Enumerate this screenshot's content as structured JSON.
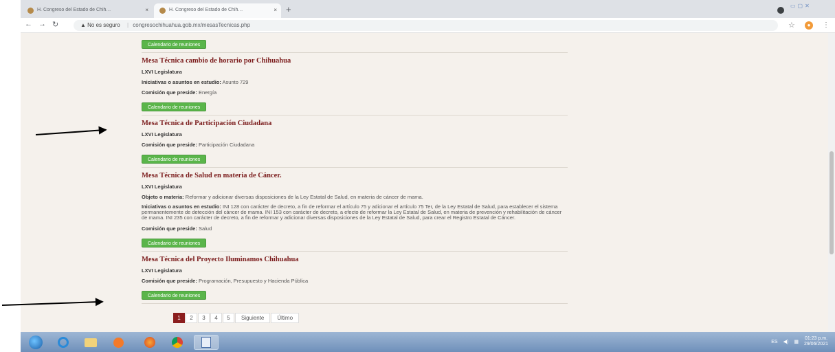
{
  "browser": {
    "tabs": [
      {
        "label": "H. Congreso del Estado de Chih…",
        "close": "×"
      },
      {
        "label": "H. Congreso del Estado de Chih…",
        "close": "×"
      }
    ],
    "new_tab": "+",
    "url_warning": "▲ No es seguro",
    "url": "congresochihuahua.gob.mx/mesasTecnicas.php"
  },
  "content": {
    "top_button": "Calendario de reuniones",
    "items": [
      {
        "title": "Mesa Técnica cambio de horario por Chihuahua",
        "legislatura": "LXVI Legislatura",
        "iniciativas_label": "Iniciativas o asuntos en estudio:",
        "iniciativas_value": " Asunto 729",
        "comision_label": "Comisión que preside:",
        "comision_value": " Energía",
        "button": "Calendario de reuniones"
      },
      {
        "title": "Mesa Técnica de Participación Ciudadana",
        "legislatura": "LXVI Legislatura",
        "comision_label": "Comisión que preside:",
        "comision_value": " Participación Ciudadana",
        "button": "Calendario de reuniones"
      },
      {
        "title": "Mesa Técnica de Salud en materia de Cáncer.",
        "legislatura": "LXVI Legislatura",
        "objeto_label": "Objeto o materia:",
        "objeto_value": " Reformar y adicionar diversas disposiciones de la Ley Estatal de Salud, en materia de cáncer de mama.",
        "iniciativas_label": "Iniciativas o asuntos en estudio:",
        "iniciativas_value": " INI 128 con carácter de decreto, a fin de reformar el artículo 75 y adicionar el artículo 75 Ter, de la Ley Estatal de Salud, para establecer el sistema permanentemente de detección del cáncer de mama. INI 153 con carácter de decreto, a efecto de reformar la Ley Estatal de Salud, en materia de prevención y rehabilitación de cáncer de mama. INI 235 con carácter de decreto, a fin de reformar y adicionar diversas disposiciones de la Ley Estatal de Salud, para crear el Registro Estatal de Cáncer.",
        "comision_label": "Comisión que preside:",
        "comision_value": " Salud",
        "button": "Calendario de reuniones"
      },
      {
        "title": "Mesa Técnica del Proyecto Iluminamos Chihuahua",
        "legislatura": "LXVI Legislatura",
        "comision_label": "Comisión que preside:",
        "comision_value": " Programación, Presupuesto y Hacienda Pública",
        "button": "Calendario de reuniones"
      }
    ],
    "pagination": [
      "1",
      "2",
      "3",
      "4",
      "5",
      "Siguiente",
      "Último"
    ]
  },
  "taskbar": {
    "tray_lang": "ES",
    "time": "01:23 p.m.",
    "date": "29/06/2021"
  }
}
